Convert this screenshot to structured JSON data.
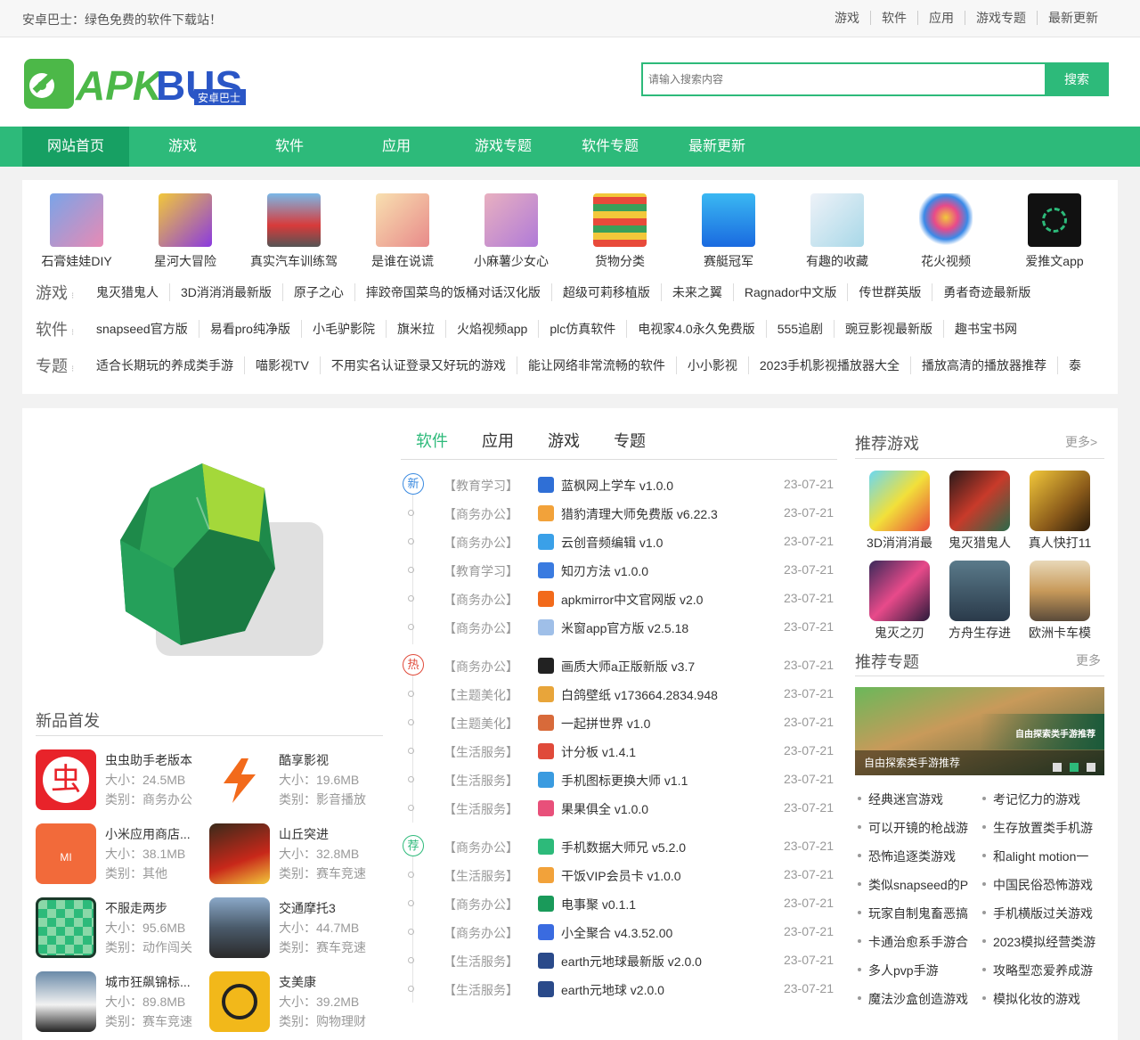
{
  "topbar": {
    "slogan": "安卓巴士：绿色免费的软件下载站！",
    "links": [
      "游戏",
      "软件",
      "应用",
      "游戏专题",
      "最新更新"
    ]
  },
  "logo": {
    "text": "APKBUS",
    "sub": "安卓巴士"
  },
  "search": {
    "placeholder": "请输入搜索内容",
    "button": "搜索"
  },
  "nav": [
    "网站首页",
    "游戏",
    "软件",
    "应用",
    "游戏专题",
    "软件专题",
    "最新更新"
  ],
  "hot_icons": [
    "石膏娃娃DIY",
    "星河大冒险",
    "真实汽车训练驾",
    "是谁在说谎",
    "小麻薯少女心",
    "货物分类",
    "赛艇冠军",
    "有趣的收藏",
    "花火视频",
    "爱推文app"
  ],
  "tags": {
    "games_label": "游戏",
    "games": [
      "鬼灭猎鬼人",
      "3D消消消最新版",
      "原子之心",
      "摔跤帝国菜鸟的饭桶对话汉化版",
      "超级可莉移植版",
      "未来之翼",
      "Ragnador中文版",
      "传世群英版",
      "勇者奇迹最新版"
    ],
    "soft_label": "软件",
    "soft": [
      "snapseed官方版",
      "易看pro纯净版",
      "小毛驴影院",
      "旗米拉",
      "火焰视频app",
      "plc仿真软件",
      "电视家4.0永久免费版",
      "555追剧",
      "豌豆影视最新版",
      "趣书宝书网"
    ],
    "topic_label": "专题",
    "topic": [
      "适合长期玩的养成类手游",
      "喵影视TV",
      "不用实名认证登录又好玩的游戏",
      "能让网络非常流畅的软件",
      "小小影视",
      "2023手机影视播放器大全",
      "播放高清的播放器推荐",
      "泰"
    ]
  },
  "new_section": {
    "title": "新品首发",
    "items": [
      {
        "name": "虫虫助手老版本",
        "size": "大小：24.5MB",
        "cat": "类别：商务办公"
      },
      {
        "name": "酷享影视",
        "size": "大小：19.6MB",
        "cat": "类别：影音播放"
      },
      {
        "name": "小米应用商店...",
        "size": "大小：38.1MB",
        "cat": "类别：其他"
      },
      {
        "name": "山丘突进",
        "size": "大小：32.8MB",
        "cat": "类别：赛车竞速"
      },
      {
        "name": "不服走两步",
        "size": "大小：95.6MB",
        "cat": "类别：动作闯关"
      },
      {
        "name": "交通摩托3",
        "size": "大小：44.7MB",
        "cat": "类别：赛车竞速"
      },
      {
        "name": "城市狂飙锦标...",
        "size": "大小：89.8MB",
        "cat": "类别：赛车竞速"
      },
      {
        "name": "支美康",
        "size": "大小：39.2MB",
        "cat": "类别：购物理财"
      }
    ]
  },
  "tabs": [
    "软件",
    "应用",
    "游戏",
    "专题"
  ],
  "badges": [
    "新",
    "热",
    "荐"
  ],
  "list": [
    {
      "cat": "【教育学习】",
      "name": "蓝枫网上学车 v1.0.0",
      "date": "23-07-21",
      "color": "#2f6fd6"
    },
    {
      "cat": "【商务办公】",
      "name": "猎豹清理大师免费版 v6.22.3",
      "date": "23-07-21",
      "color": "#f2a23a"
    },
    {
      "cat": "【商务办公】",
      "name": "云创音频编辑 v1.0",
      "date": "23-07-21",
      "color": "#3aa0e8"
    },
    {
      "cat": "【教育学习】",
      "name": "知刃方法 v1.0.0",
      "date": "23-07-21",
      "color": "#3a7be0"
    },
    {
      "cat": "【商务办公】",
      "name": "apkmirror中文官网版 v2.0",
      "date": "23-07-21",
      "color": "#f26a1b"
    },
    {
      "cat": "【商务办公】",
      "name": "米窗app官方版 v2.5.18",
      "date": "23-07-21",
      "color": "#9fbfe8"
    },
    {
      "cat": "【商务办公】",
      "name": "画质大师a正版新版 v3.7",
      "date": "23-07-21",
      "color": "#222222"
    },
    {
      "cat": "【主题美化】",
      "name": "白鸽壁纸 v173664.2834.948",
      "date": "23-07-21",
      "color": "#e8a53a"
    },
    {
      "cat": "【主题美化】",
      "name": "一起拼世界 v1.0",
      "date": "23-07-21",
      "color": "#d86a3a"
    },
    {
      "cat": "【生活服务】",
      "name": "计分板 v1.4.1",
      "date": "23-07-21",
      "color": "#e04a3a"
    },
    {
      "cat": "【生活服务】",
      "name": "手机图标更换大师 v1.1",
      "date": "23-07-21",
      "color": "#3a9be0"
    },
    {
      "cat": "【生活服务】",
      "name": "果果俱全 v1.0.0",
      "date": "23-07-21",
      "color": "#e8507a"
    },
    {
      "cat": "【商务办公】",
      "name": "手机数据大师兄 v5.2.0",
      "date": "23-07-21",
      "color": "#2dba7a"
    },
    {
      "cat": "【生活服务】",
      "name": "干饭VIP会员卡 v1.0.0",
      "date": "23-07-21",
      "color": "#f2a23a"
    },
    {
      "cat": "【商务办公】",
      "name": "电事聚 v0.1.1",
      "date": "23-07-21",
      "color": "#1a9a5a"
    },
    {
      "cat": "【商务办公】",
      "name": "小全聚合 v4.3.52.00",
      "date": "23-07-21",
      "color": "#3a6be0"
    },
    {
      "cat": "【生活服务】",
      "name": "earth元地球最新版 v2.0.0",
      "date": "23-07-21",
      "color": "#2a4a8a"
    },
    {
      "cat": "【生活服务】",
      "name": "earth元地球 v2.0.0",
      "date": "23-07-21",
      "color": "#2a4a8a"
    }
  ],
  "rec_games": {
    "title": "推荐游戏",
    "more": "更多>",
    "items": [
      "3D消消消最",
      "鬼灭猎鬼人",
      "真人快打11",
      "鬼灭之刃",
      "方舟生存进",
      "欧洲卡车模"
    ]
  },
  "rec_topics": {
    "title": "推荐专题",
    "more": "更多",
    "banner_caption": "自由探索类手游推荐",
    "banner_text": "自由探索类手游推荐",
    "left": [
      "经典迷宫游戏",
      "可以开镜的枪战游",
      "恐怖追逐类游戏",
      "类似snapseed的P",
      "玩家自制鬼畜恶搞",
      "卡通治愈系手游合",
      "多人pvp手游",
      "魔法沙盒创造游戏"
    ],
    "right": [
      "考记忆力的游戏",
      "生存放置类手机游",
      "和alight motion一",
      "中国民俗恐怖游戏",
      "手机横版过关游戏",
      "2023模拟经营类游",
      "攻略型恋爱养成游",
      "模拟化妆的游戏"
    ]
  },
  "colors": {
    "accent": "#2dba7a",
    "nav_active": "#17a063",
    "hot_badge": "#e04a3a"
  }
}
